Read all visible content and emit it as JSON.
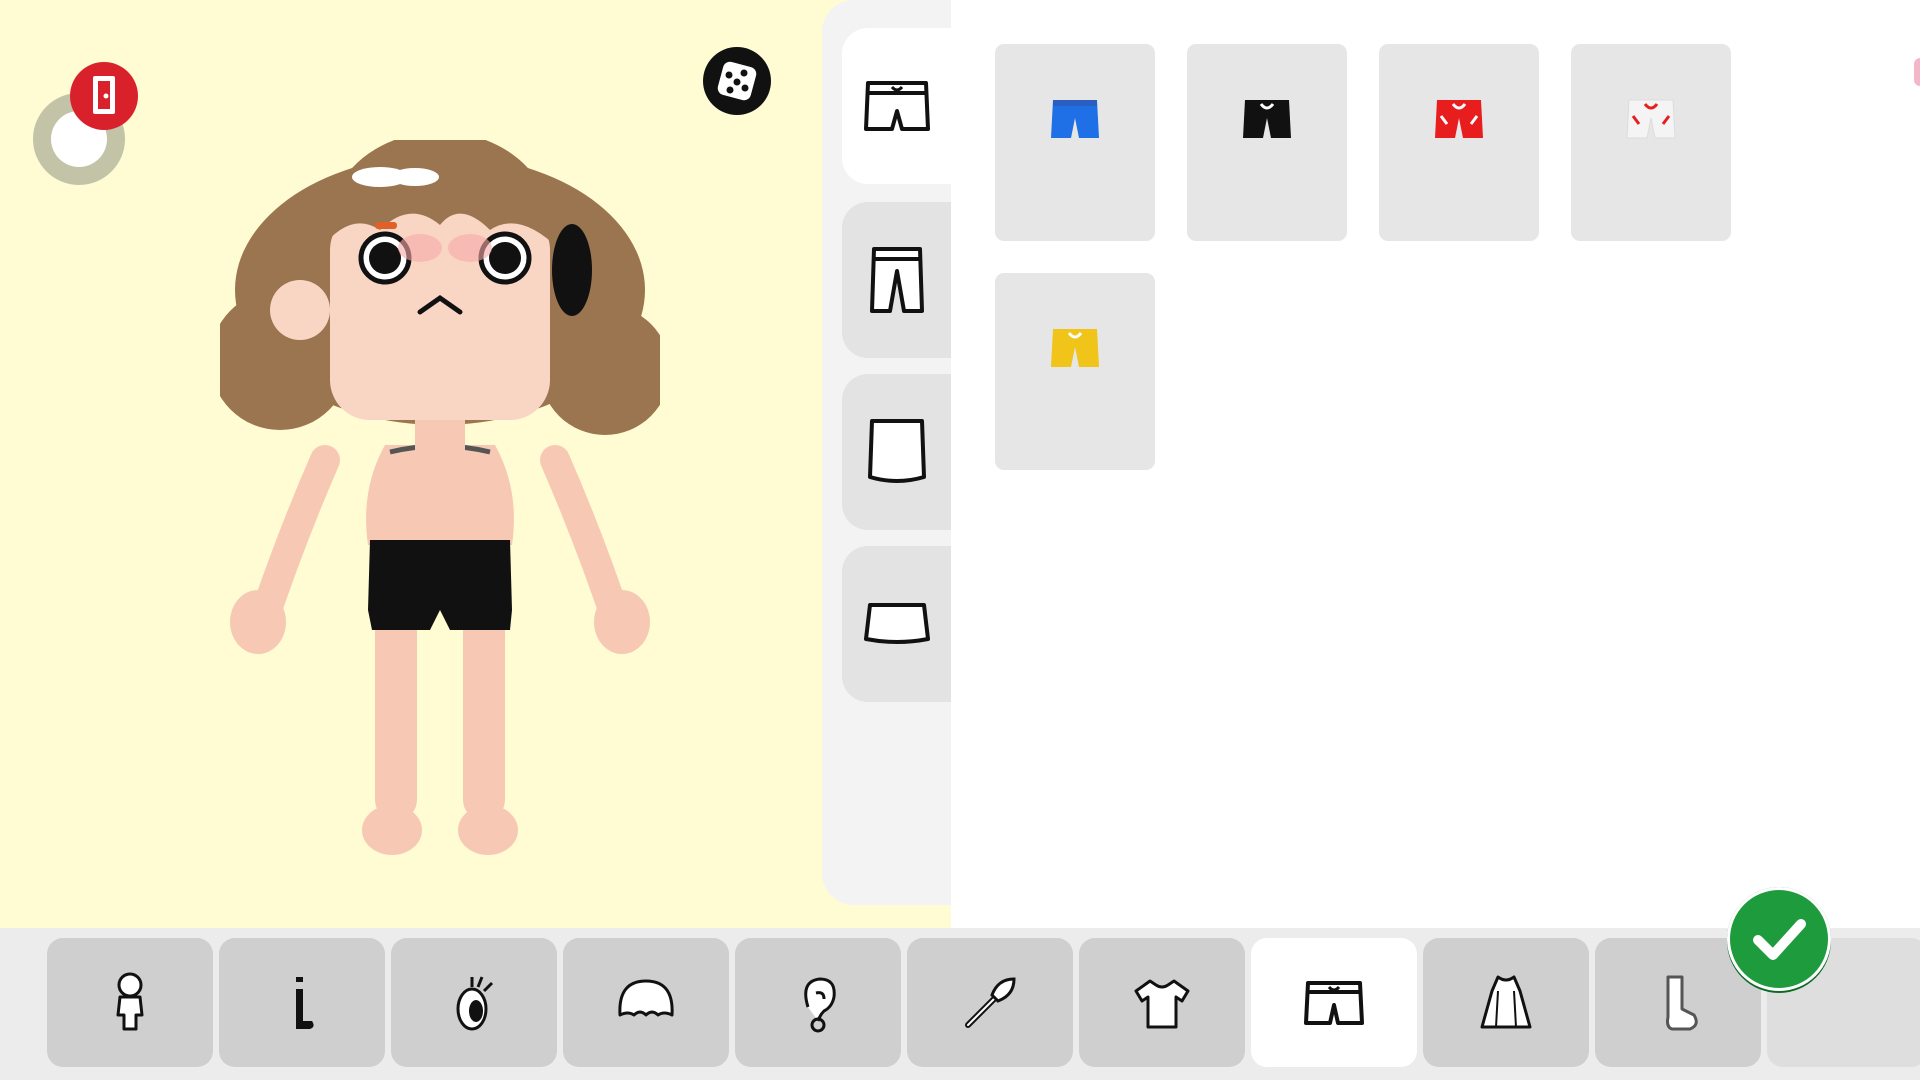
{
  "colors": {
    "stage_bg": "#fffbd3",
    "panel_bg": "#f3f3f3",
    "tab_bg": "#cfcfcf",
    "active_tab_bg": "#ffffff",
    "confirm_green": "#1e9b3c",
    "exit_red": "#d9212c"
  },
  "stage": {
    "exit_icon": "door-exit-icon",
    "joystick_icon": "joystick-icon",
    "dice_icon": "dice-icon"
  },
  "subcategories": [
    {
      "name": "shorts",
      "icon": "shorts-icon",
      "active": true
    },
    {
      "name": "pants",
      "icon": "pants-icon",
      "active": false
    },
    {
      "name": "long-skirt",
      "icon": "skirt-long-icon",
      "active": false
    },
    {
      "name": "short-skirt",
      "icon": "skirt-short-icon",
      "active": false
    }
  ],
  "items": [
    {
      "name": "blue-shorts",
      "color": "#1f6fe6"
    },
    {
      "name": "black-shorts",
      "color": "#111111"
    },
    {
      "name": "red-shorts",
      "color": "#e81d1d"
    },
    {
      "name": "white-shorts",
      "color": "#f4f4f4"
    },
    {
      "name": "yellow-shorts",
      "color": "#f0c419"
    }
  ],
  "categories": [
    {
      "name": "body",
      "icon": "body-icon",
      "active": false
    },
    {
      "name": "skin",
      "icon": "leg-skin-icon",
      "active": false
    },
    {
      "name": "eyes",
      "icon": "eye-icon",
      "active": false
    },
    {
      "name": "hair",
      "icon": "hair-icon",
      "active": false
    },
    {
      "name": "ears",
      "icon": "ear-icon",
      "active": false
    },
    {
      "name": "makeup",
      "icon": "makeup-brush-icon",
      "active": false
    },
    {
      "name": "tops",
      "icon": "shirt-icon",
      "active": false
    },
    {
      "name": "bottoms",
      "icon": "shorts-icon",
      "active": true
    },
    {
      "name": "dresses",
      "icon": "dress-icon",
      "active": false
    },
    {
      "name": "socks",
      "icon": "sock-icon",
      "active": false
    }
  ],
  "confirm": {
    "icon": "checkmark-icon"
  }
}
